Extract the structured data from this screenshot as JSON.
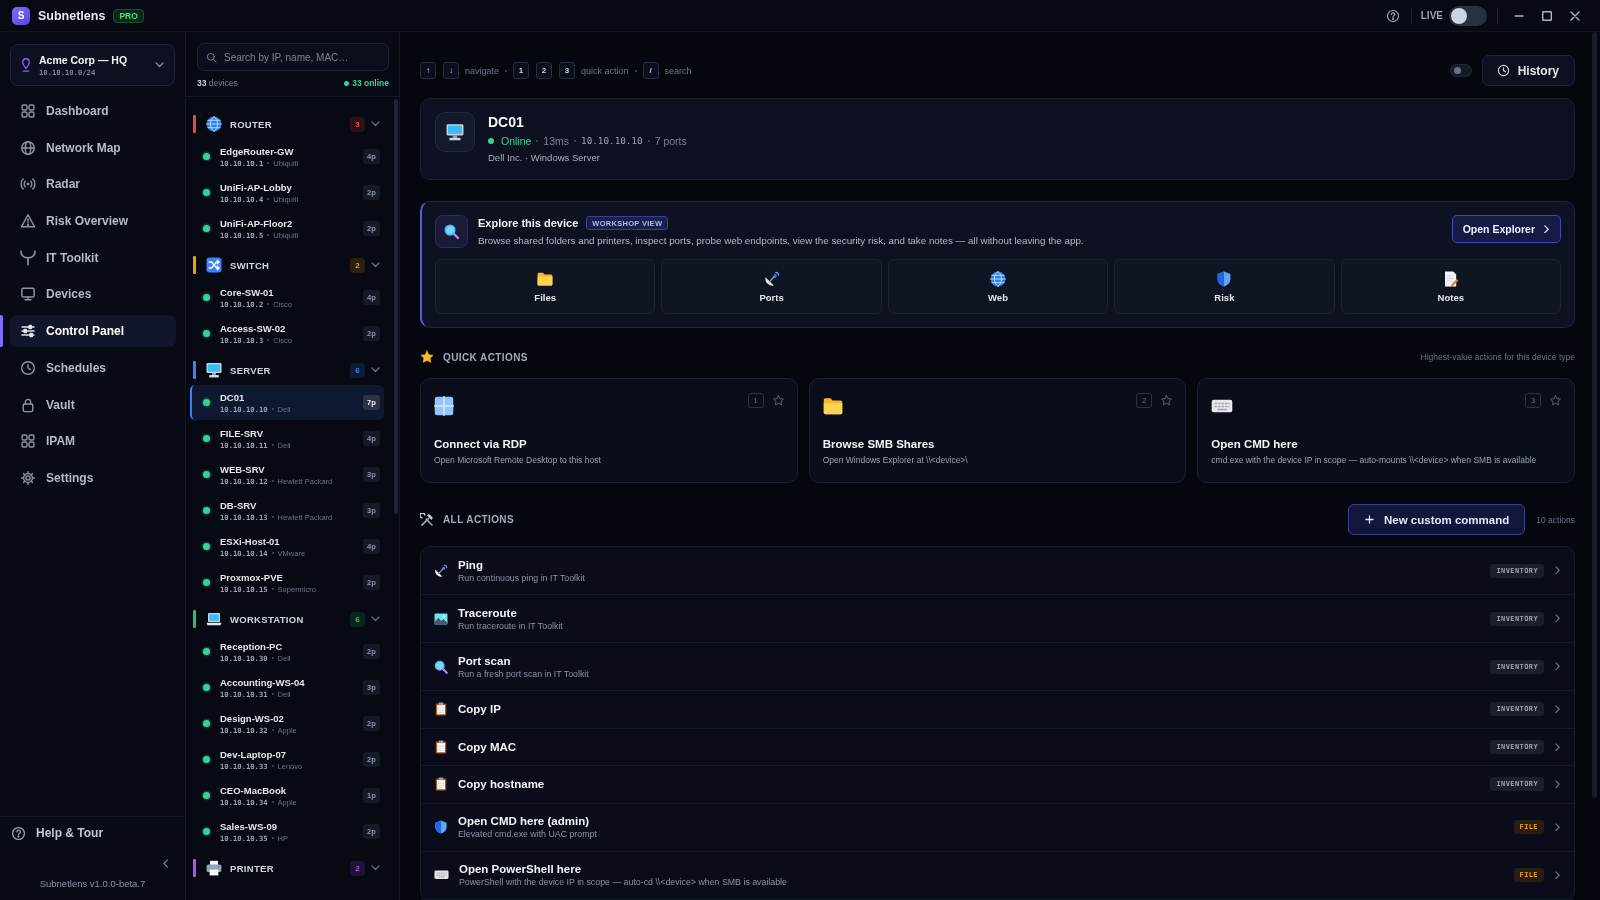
{
  "app": {
    "logo_letter": "S",
    "name": "Subnetlens",
    "badge": "PRO"
  },
  "title_bar": {
    "live": {
      "label": "LIVE",
      "on": false
    }
  },
  "workspace": {
    "name": "Acme Corp — HQ",
    "subnet": "10.10.10.0/24"
  },
  "nav": [
    {
      "label": "Dashboard",
      "selected": false
    },
    {
      "label": "Network Map",
      "selected": false
    },
    {
      "label": "Radar",
      "selected": false
    },
    {
      "label": "Risk Overview",
      "selected": false
    },
    {
      "label": "IT Toolkit",
      "selected": false
    },
    {
      "label": "Devices",
      "selected": false
    },
    {
      "label": "Control Panel",
      "selected": true
    },
    {
      "label": "Schedules",
      "selected": false
    },
    {
      "label": "Vault",
      "selected": false
    },
    {
      "label": "IPAM",
      "selected": false
    },
    {
      "label": "Settings",
      "selected": false
    }
  ],
  "sidebar_footer": {
    "help": "Help & Tour",
    "version": "Subnetlens v1.0.0-beta.7"
  },
  "device_list": {
    "search": {
      "placeholder": "Search by IP, name, MAC…"
    },
    "total": "**33** devices",
    "online": "33 online",
    "groups": [
      {
        "name": "ROUTER",
        "count": "3",
        "color": "#ef4444",
        "expanded": true,
        "devices": [
          {
            "name": "EdgeRouter-GW",
            "ip": "10.10.10.1",
            "vendor": "Ubiquiti",
            "ports": "4p",
            "online": true,
            "selected": false
          },
          {
            "name": "UniFi-AP-Lobby",
            "ip": "10.10.10.4",
            "vendor": "Ubiquiti",
            "ports": "2p",
            "online": true,
            "selected": false
          },
          {
            "name": "UniFi-AP-Floor2",
            "ip": "10.10.10.5",
            "vendor": "Ubiquiti",
            "ports": "2p",
            "online": true,
            "selected": false
          }
        ]
      },
      {
        "name": "SWITCH",
        "count": "2",
        "color": "#f59e0b",
        "expanded": true,
        "devices": [
          {
            "name": "Core-SW-01",
            "ip": "10.10.10.2",
            "vendor": "Cisco",
            "ports": "4p",
            "online": true,
            "selected": false
          },
          {
            "name": "Access-SW-02",
            "ip": "10.10.10.3",
            "vendor": "Cisco",
            "ports": "2p",
            "online": true,
            "selected": false
          }
        ]
      },
      {
        "name": "SERVER",
        "count": "6",
        "color": "#3b82f6",
        "expanded": true,
        "devices": [
          {
            "name": "DC01",
            "ip": "10.10.10.10",
            "vendor": "Dell",
            "ports": "7p",
            "online": true,
            "selected": true
          },
          {
            "name": "FILE-SRV",
            "ip": "10.10.10.11",
            "vendor": "Dell",
            "ports": "4p",
            "online": true,
            "selected": false
          },
          {
            "name": "WEB-SRV",
            "ip": "10.10.10.12",
            "vendor": "Hewlett Packard",
            "ports": "3p",
            "online": true,
            "selected": false
          },
          {
            "name": "DB-SRV",
            "ip": "10.10.10.13",
            "vendor": "Hewlett Packard",
            "ports": "3p",
            "online": true,
            "selected": false
          },
          {
            "name": "ESXi-Host-01",
            "ip": "10.10.10.14",
            "vendor": "VMware",
            "ports": "4p",
            "online": true,
            "selected": false
          },
          {
            "name": "Proxmox-PVE",
            "ip": "10.10.10.15",
            "vendor": "Supermicro",
            "ports": "2p",
            "online": true,
            "selected": false
          }
        ]
      },
      {
        "name": "WORKSTATION",
        "count": "6",
        "color": "#22c55e",
        "expanded": true,
        "devices": [
          {
            "name": "Reception-PC",
            "ip": "10.10.10.30",
            "vendor": "Dell",
            "ports": "2p",
            "online": true,
            "selected": false
          },
          {
            "name": "Accounting-WS-04",
            "ip": "10.10.10.31",
            "vendor": "Dell",
            "ports": "3p",
            "online": true,
            "selected": false
          },
          {
            "name": "Design-WS-02",
            "ip": "10.10.10.32",
            "vendor": "Apple",
            "ports": "2p",
            "online": true,
            "selected": false
          },
          {
            "name": "Dev-Laptop-07",
            "ip": "10.10.10.33",
            "vendor": "Lenovo",
            "ports": "2p",
            "online": true,
            "selected": false
          },
          {
            "name": "CEO-MacBook",
            "ip": "10.10.10.34",
            "vendor": "Apple",
            "ports": "1p",
            "online": true,
            "selected": false
          },
          {
            "name": "Sales-WS-09",
            "ip": "10.10.10.35",
            "vendor": "HP",
            "ports": "2p",
            "online": true,
            "selected": false
          }
        ]
      },
      {
        "name": "PRINTER",
        "count": "2",
        "color": "#a855f7",
        "expanded": true
      }
    ]
  },
  "toolbar": {
    "shortcuts": [
      {
        "keys": [
          "↑",
          "↓"
        ],
        "label": "navigate"
      },
      {
        "keys": [
          "1",
          "2",
          "3"
        ],
        "label": "quick action"
      },
      {
        "keys": [
          "/"
        ],
        "label": "search"
      }
    ],
    "toggle": {
      "on": false
    },
    "history_button": "History"
  },
  "device": {
    "name": "DC01",
    "online": true,
    "status": "Online",
    "latency": "13ms",
    "ip": "10.10.10.10",
    "ports": "7 ports",
    "details": "Dell Inc. · Windows Server"
  },
  "explore": {
    "title": "Explore this device",
    "badge": "WORKSHOP VIEW",
    "description": "Browse shared folders and printers, inspect ports, probe web endpoints, view the security risk, and take notes — all without leaving the app.",
    "button": "Open Explorer",
    "tiles": [
      "Files",
      "Ports",
      "Web",
      "Risk",
      "Notes"
    ]
  },
  "quick_actions": {
    "title": "QUICK ACTIONS",
    "hint": "Highest-value actions for this device type",
    "cards": [
      {
        "title": "Connect via RDP",
        "description": "Open Microsoft Remote Desktop to this host",
        "key": "1",
        "starred": false
      },
      {
        "title": "Browse SMB Shares",
        "description": "Open Windows Explorer at \\\\<device>\\",
        "key": "2",
        "starred": false
      },
      {
        "title": "Open CMD here",
        "description": "cmd.exe with the device IP in scope — auto-mounts \\\\<device> when SMB is available",
        "key": "3",
        "starred": false
      }
    ]
  },
  "all_actions": {
    "title": "ALL ACTIONS",
    "button": "New custom command",
    "count": "10 actions",
    "rows": [
      {
        "title": "Ping",
        "subtitle": "Run continuous ping in IT Toolkit",
        "tag": {
          "label": "INVENTORY",
          "color": "#9ca3af"
        }
      },
      {
        "title": "Traceroute",
        "subtitle": "Run traceroute in IT Toolkit",
        "tag": {
          "label": "INVENTORY",
          "color": "#9ca3af"
        }
      },
      {
        "title": "Port scan",
        "subtitle": "Run a fresh port scan in IT Toolkit",
        "tag": {
          "label": "INVENTORY",
          "color": "#9ca3af"
        }
      },
      {
        "title": "Copy IP",
        "tag": {
          "label": "INVENTORY",
          "color": "#9ca3af"
        }
      },
      {
        "title": "Copy MAC",
        "tag": {
          "label": "INVENTORY",
          "color": "#9ca3af"
        }
      },
      {
        "title": "Copy hostname",
        "tag": {
          "label": "INVENTORY",
          "color": "#9ca3af"
        }
      },
      {
        "title": "Open CMD here (admin)",
        "subtitle": "Elevated cmd.exe with UAC prompt",
        "tag": {
          "label": "FILE",
          "color": "#f59e0b"
        }
      },
      {
        "title": "Open PowerShell here",
        "subtitle": "PowerShell with the device IP in scope — auto-cd \\\\<device> when SMB is available",
        "tag": {
          "label": "FILE",
          "color": "#f59e0b"
        }
      }
    ]
  }
}
